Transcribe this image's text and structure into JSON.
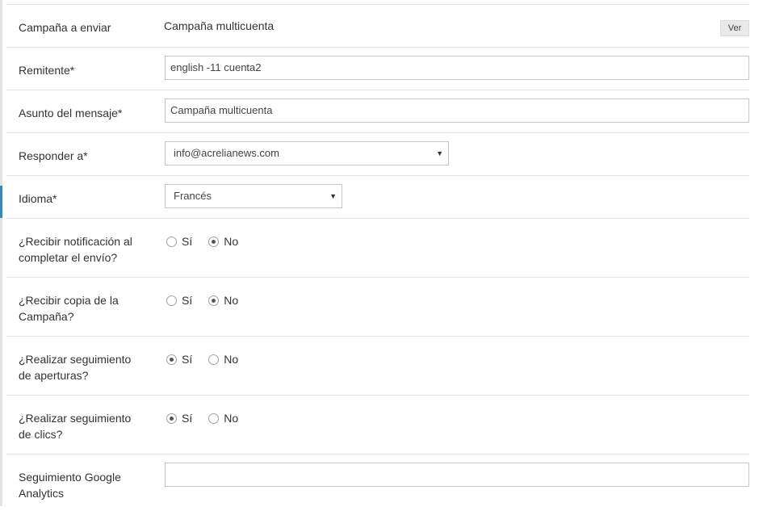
{
  "form": {
    "campaign": {
      "label": "Campaña a enviar",
      "value": "Campaña multicuenta",
      "view_button": "Ver"
    },
    "sender": {
      "label": "Remitente*",
      "value": "english -11 cuenta2"
    },
    "subject": {
      "label": "Asunto del mensaje*",
      "value": "Campaña multicuenta"
    },
    "reply_to": {
      "label": "Responder a*",
      "value": "info@acrelianews.com"
    },
    "language": {
      "label": "Idioma*",
      "value": "Francés"
    },
    "notify": {
      "label_line1": "¿Recibir notificación al",
      "label_line2": "completar el envío?",
      "yes": "Sí",
      "no": "No",
      "selected": "no"
    },
    "copy": {
      "label_line1": "¿Recibir copia de la",
      "label_line2": "Campaña?",
      "yes": "Sí",
      "no": "No",
      "selected": "no"
    },
    "track_opens": {
      "label_line1": "¿Realizar seguimiento",
      "label_line2": "de aperturas?",
      "yes": "Sí",
      "no": "No",
      "selected": "yes"
    },
    "track_clicks": {
      "label_line1": "¿Realizar seguimiento",
      "label_line2": "de clics?",
      "yes": "Sí",
      "no": "No",
      "selected": "yes"
    },
    "google_analytics": {
      "label_line1": "Seguimiento Google",
      "label_line2": "Analytics",
      "value": ""
    }
  },
  "icons": {
    "dropdown": "caret-down-icon"
  },
  "colors": {
    "accent": "#2e8bc7",
    "border": "#c6c6c6"
  }
}
